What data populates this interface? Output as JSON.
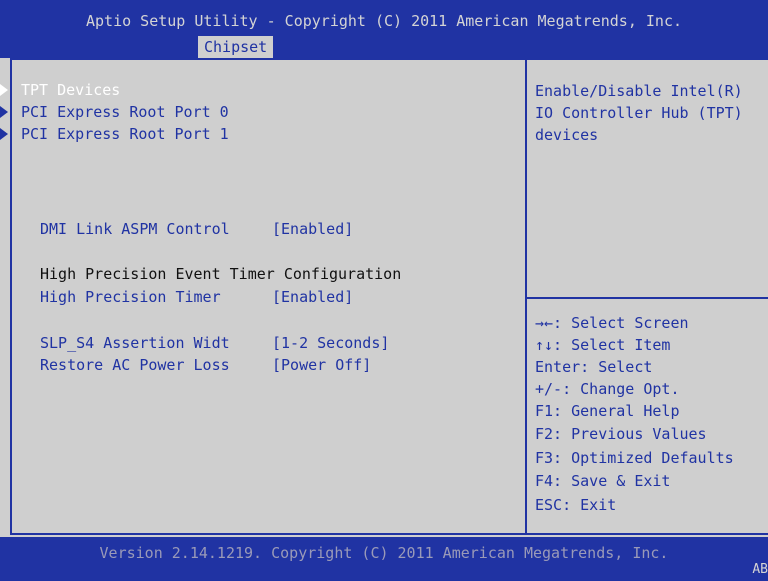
{
  "header": {
    "title": "Aptio Setup Utility - Copyright (C) 2011 American Megatrends, Inc.",
    "active_tab": "Chipset"
  },
  "menu": {
    "submenus": [
      {
        "label": "TPT Devices",
        "selected": true
      },
      {
        "label": "PCI Express Root Port 0",
        "selected": false
      },
      {
        "label": "PCI Express Root Port 1",
        "selected": false
      }
    ],
    "dmi_link": {
      "label": "DMI Link ASPM Control",
      "value": "[Enabled]"
    },
    "hpet_section": "High Precision Event Timer Configuration",
    "hpet": {
      "label": "High Precision Timer",
      "value": "[Enabled]"
    },
    "slp_s4": {
      "label": "SLP_S4 Assertion Widt",
      "value": "[1-2 Seconds]"
    },
    "restore_ac": {
      "label": "Restore AC Power Loss",
      "value": "[Power Off]"
    }
  },
  "help": {
    "description": [
      "Enable/Disable Intel(R)",
      "IO Controller Hub (TPT)",
      "devices"
    ],
    "keys": [
      "→←: Select Screen",
      "↑↓: Select Item",
      "Enter: Select",
      "+/-: Change Opt.",
      "F1: General Help",
      "F2: Previous Values",
      "F3: Optimized Defaults",
      "F4: Save & Exit",
      "ESC: Exit"
    ]
  },
  "footer": {
    "text": "Version 2.14.1219. Copyright (C) 2011 American Megatrends, Inc.",
    "corner": "AB"
  },
  "colors": {
    "bios_blue": "#2033a3",
    "panel_gray": "#cfcfcf",
    "selected_text": "#ffffff"
  }
}
